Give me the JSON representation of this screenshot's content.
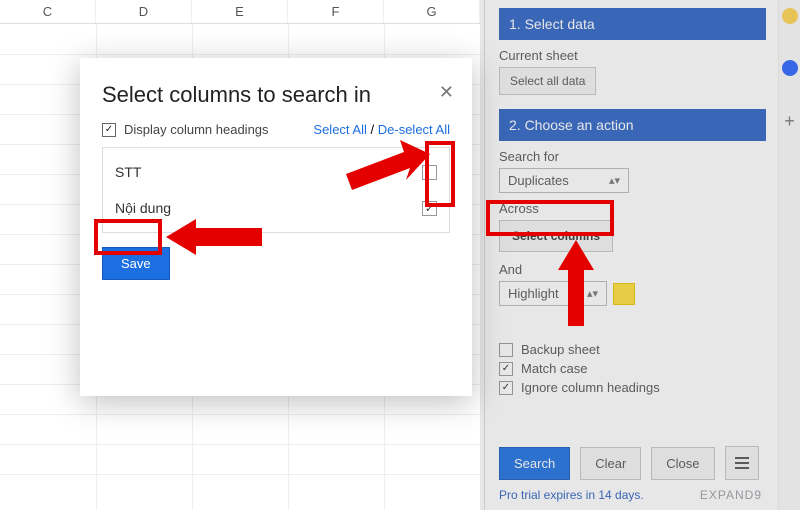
{
  "spreadsheet": {
    "columns": [
      "C",
      "D",
      "E",
      "F",
      "G"
    ]
  },
  "panel": {
    "step1": {
      "title": "1. Select data"
    },
    "current_sheet_label": "Current sheet",
    "select_all_data_label": "Select all data",
    "step2": {
      "title": "2. Choose an action"
    },
    "search_for_label": "Search for",
    "search_for_value": "Duplicates",
    "across_label": "Across",
    "select_columns_label": "Select columns",
    "and_label": "And",
    "action_value": "Highlight",
    "options": {
      "backup": "Backup sheet",
      "match_case": "Match case",
      "ignore_headings": "Ignore column headings"
    },
    "search_btn": "Search",
    "clear_btn": "Clear",
    "close_btn": "Close",
    "trial_text": "Pro trial expires in 14 days.",
    "brand": "EXPAND9"
  },
  "modal": {
    "title": "Select columns to search in",
    "display_headings_label": "Display column headings",
    "select_all_label": "Select All",
    "deselect_all_label": "De-select All",
    "columns": [
      {
        "name": "STT",
        "checked": false
      },
      {
        "name": "Nội dung",
        "checked": true
      }
    ],
    "save_label": "Save"
  }
}
